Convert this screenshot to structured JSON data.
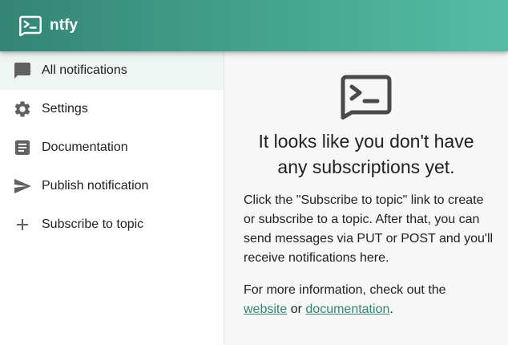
{
  "app": {
    "title": "ntfy"
  },
  "sidebar": {
    "items": [
      {
        "label": "All notifications",
        "icon": "chat-bubble-icon",
        "selected": true
      },
      {
        "label": "Settings",
        "icon": "gear-icon",
        "selected": false
      },
      {
        "label": "Documentation",
        "icon": "article-icon",
        "selected": false
      },
      {
        "label": "Publish notification",
        "icon": "send-icon",
        "selected": false
      },
      {
        "label": "Subscribe to topic",
        "icon": "plus-icon",
        "selected": false
      }
    ]
  },
  "main": {
    "icon": "terminal-icon",
    "headline_line1": "It looks like you don't have",
    "headline_line2": "any subscriptions yet.",
    "paragraph1": "Click the \"Subscribe to topic\" link to create or subscribe to a topic. After that, you can send messages via PUT or POST and you'll receive notifications here.",
    "paragraph2_prefix": "For more information, check out the",
    "link_website": "website",
    "link_or": "or",
    "link_documentation": "documentation",
    "paragraph2_suffix": "."
  },
  "colors": {
    "accent": "#338574",
    "appbar_gradient_start": "#338574",
    "appbar_gradient_end": "#56bda4",
    "selected_bg": "#eef5f3",
    "icon_gray": "#616161"
  }
}
